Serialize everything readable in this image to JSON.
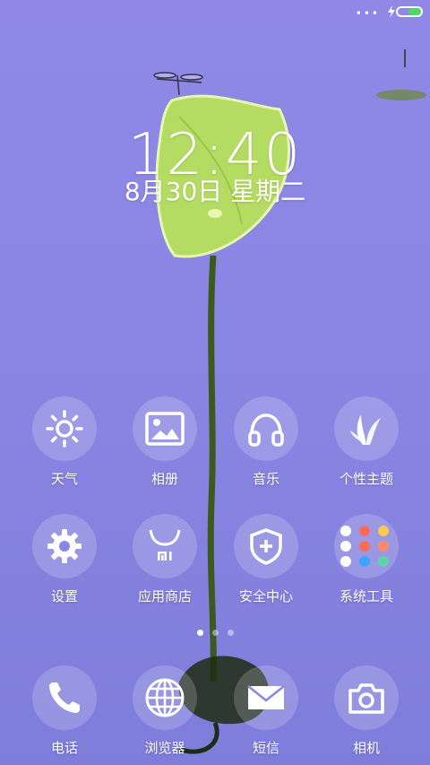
{
  "status": {
    "signal_icon": "more-dots-icon",
    "charging_icon": "bolt-icon",
    "battery_level": 0.55,
    "battery_color": "#4cd964"
  },
  "lockscreen": {
    "time": "12:40",
    "date": "8月30日 星期二"
  },
  "apps": [
    {
      "label": "天气",
      "icon": "sun-icon"
    },
    {
      "label": "相册",
      "icon": "image-icon"
    },
    {
      "label": "音乐",
      "icon": "headphones-icon"
    },
    {
      "label": "个性主题",
      "icon": "leaf-icon"
    },
    {
      "label": "设置",
      "icon": "gear-icon"
    },
    {
      "label": "应用商店",
      "icon": "mi-bag-icon"
    },
    {
      "label": "安全中心",
      "icon": "shield-icon"
    },
    {
      "label": "系统工具",
      "icon": "tools-folder-icon"
    }
  ],
  "page_indicator": {
    "count": 3,
    "active": 0
  },
  "dock": [
    {
      "label": "电话",
      "icon": "phone-icon"
    },
    {
      "label": "浏览器",
      "icon": "globe-icon"
    },
    {
      "label": "短信",
      "icon": "envelope-icon"
    },
    {
      "label": "相机",
      "icon": "camera-icon"
    }
  ],
  "colors": {
    "background": "#8a86e3",
    "leaf": "#a9d65a",
    "stem": "#3c5a24"
  }
}
